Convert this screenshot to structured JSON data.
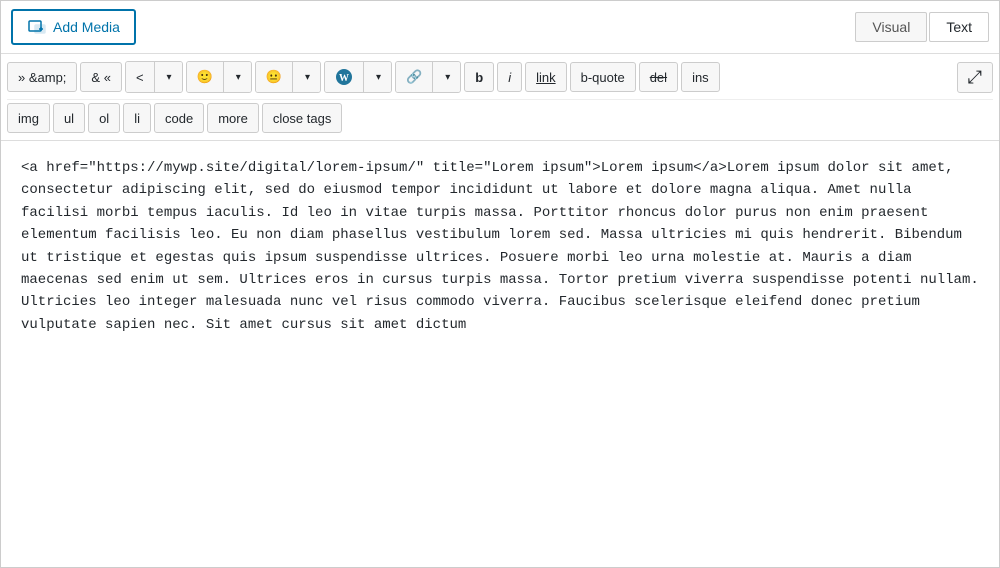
{
  "topbar": {
    "add_media_label": "Add Media",
    "visual_tab_label": "Visual",
    "text_tab_label": "Text",
    "active_tab": "Text"
  },
  "toolbar": {
    "row1": {
      "buttons": [
        {
          "id": "ampamp",
          "label": "» &amp;"
        },
        {
          "id": "amp",
          "label": "& «"
        },
        {
          "id": "lt",
          "label": "<"
        },
        {
          "id": "emoji1",
          "label": "🙂"
        },
        {
          "id": "emoji2",
          "label": "😐"
        },
        {
          "id": "wp",
          "label": "Ⓦ"
        },
        {
          "id": "link",
          "label": "🔗"
        },
        {
          "id": "bold",
          "label": "b"
        },
        {
          "id": "italic",
          "label": "i"
        },
        {
          "id": "link2",
          "label": "link"
        },
        {
          "id": "bquote",
          "label": "b-quote"
        },
        {
          "id": "del",
          "label": "del"
        },
        {
          "id": "ins",
          "label": "ins"
        },
        {
          "id": "fullscreen",
          "label": "⤢"
        }
      ]
    },
    "row2": {
      "buttons": [
        {
          "id": "img",
          "label": "img"
        },
        {
          "id": "ul",
          "label": "ul"
        },
        {
          "id": "ol",
          "label": "ol"
        },
        {
          "id": "li",
          "label": "li"
        },
        {
          "id": "code",
          "label": "code"
        },
        {
          "id": "more",
          "label": "more"
        },
        {
          "id": "close_tags",
          "label": "close tags"
        }
      ]
    }
  },
  "editor": {
    "content": "<a href=\"https://mywp.site/digital/lorem-ipsum/\" title=\"Lorem ipsum\">Lorem ipsum</a>Lorem ipsum dolor sit amet, consectetur adipiscing elit, sed do eiusmod tempor incididunt ut labore et dolore magna aliqua. Amet nulla facilisi morbi tempus iaculis. Id leo in vitae turpis massa. Porttitor rhoncus dolor purus non enim praesent elementum facilisis leo. Eu non diam phasellus vestibulum lorem sed. Massa ultricies mi quis hendrerit. Bibendum ut tristique et egestas quis ipsum suspendisse ultrices. Posuere morbi leo urna molestie at. Mauris a diam maecenas sed enim ut sem. Ultrices eros in cursus turpis massa. Tortor pretium viverra suspendisse potenti nullam. Ultricies leo integer malesuada nunc vel risus commodo viverra. Faucibus scelerisque eleifend donec pretium vulputate sapien nec. Sit amet cursus sit amet dictum"
  },
  "icons": {
    "add_media": "◫",
    "dropdown_arrow": "▾",
    "fullscreen": "⤢",
    "link": "⛓"
  }
}
